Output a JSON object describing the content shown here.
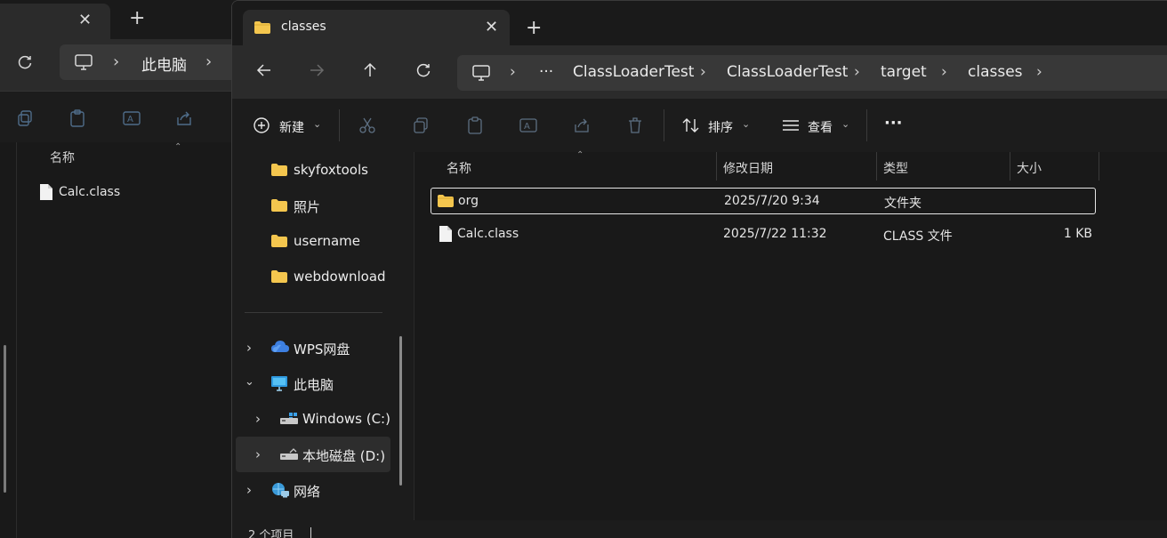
{
  "background_window": {
    "location_label": "此电脑",
    "column_name": "名称",
    "file_name": "Calc.class"
  },
  "tab": {
    "title": "classes"
  },
  "breadcrumb": {
    "overflow": "···",
    "items": [
      "ClassLoaderTest",
      "ClassLoaderTest",
      "target",
      "classes"
    ]
  },
  "toolbar": {
    "new_label": "新建",
    "sort_label": "排序",
    "view_label": "查看",
    "more_label": "···"
  },
  "nav": {
    "quick": [
      "skyfoxtools",
      "照片",
      "username",
      "webdownload"
    ],
    "wps": "WPS网盘",
    "this_pc": "此电脑",
    "drive_c": "Windows  (C:)",
    "drive_d": "本地磁盘 (D:)",
    "network": "网络"
  },
  "columns": {
    "name": "名称",
    "modified": "修改日期",
    "type": "类型",
    "size": "大小"
  },
  "files": [
    {
      "name": "org",
      "modified": "2025/7/20 9:34",
      "type": "文件夹",
      "size": "",
      "icon": "folder-icon"
    },
    {
      "name": "Calc.class",
      "modified": "2025/7/22 11:32",
      "type": "CLASS 文件",
      "size": "1 KB",
      "icon": "file-icon"
    }
  ],
  "status": {
    "item_count": "2 个项目"
  },
  "colors": {
    "folder": "#f4c64e",
    "accent": "#60cdff"
  }
}
